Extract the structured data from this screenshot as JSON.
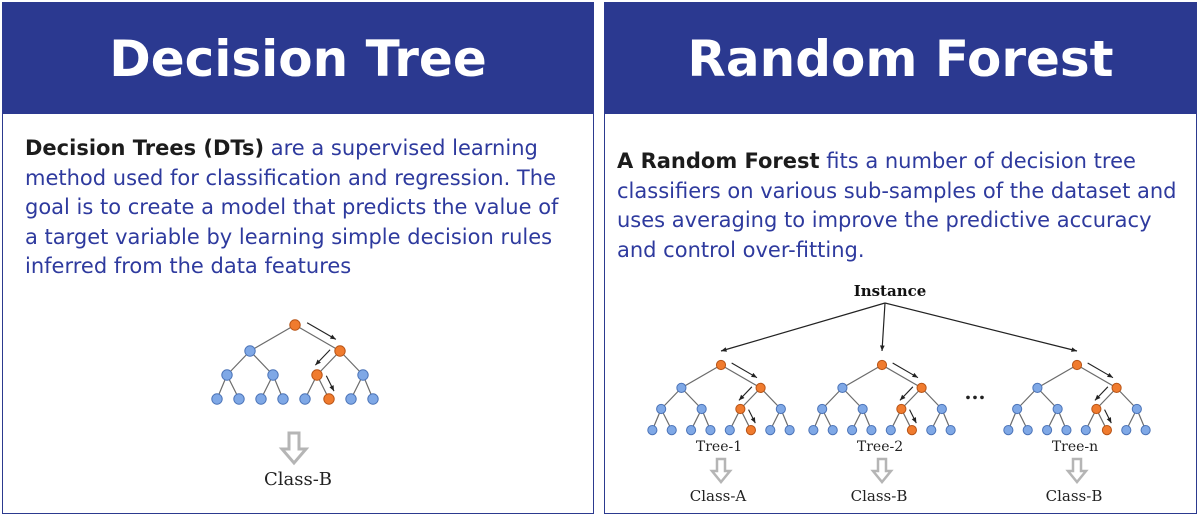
{
  "decision_tree": {
    "title": "Decision Tree",
    "description_bold": "Decision Trees (DTs)",
    "description_rest": " are a supervised learning method used for classification and regression. The goal is to create a model that predicts the value of a target variable by learning simple decision rules inferred from the data features",
    "diagram": {
      "output_label": "Class-B"
    }
  },
  "random_forest": {
    "title": "Random Forest",
    "description_bold": "A Random Forest",
    "description_rest": " fits a number of decision tree classifiers on various sub-samples of the dataset and uses averaging to improve the predictive accuracy and control over-fitting.",
    "diagram": {
      "root_label": "Instance",
      "ellipsis": "...",
      "trees": [
        {
          "label": "Tree-1",
          "output": "Class-A"
        },
        {
          "label": "Tree-2",
          "output": "Class-B"
        },
        {
          "label": "Tree-n",
          "output": "Class-B"
        }
      ]
    }
  },
  "colors": {
    "header_bg": "#2b3990",
    "text_blue": "#2e3a9e",
    "node_blue": "#7fa8e6",
    "node_orange": "#f07b2e"
  }
}
